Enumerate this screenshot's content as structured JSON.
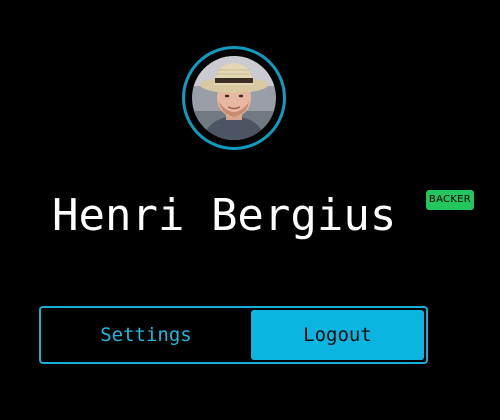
{
  "profile": {
    "name": "Henri Bergius",
    "badge": "BACKER",
    "avatar_alt": "Henri Bergius avatar"
  },
  "actions": {
    "settings_label": "Settings",
    "logout_label": "Logout"
  },
  "colors": {
    "background": "#000000",
    "accent": "#0ab5df",
    "ring": "#0f9bbf",
    "badge": "#22c55e",
    "text": "#ffffff"
  }
}
